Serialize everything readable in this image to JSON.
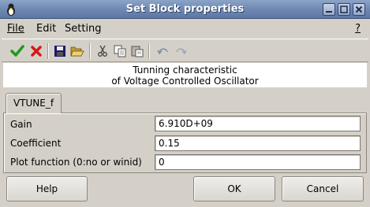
{
  "window": {
    "title": "Set Block properties",
    "controls": [
      "minimize",
      "maximize",
      "close"
    ]
  },
  "menu": {
    "file": "File",
    "edit": "Edit",
    "setting": "Setting",
    "help": "?"
  },
  "toolbar": {
    "icons": [
      "check-icon",
      "cancel-icon",
      "save-icon",
      "open-folder-icon",
      "cut-icon",
      "copy-icon",
      "paste-icon",
      "undo-icon",
      "redo-icon"
    ]
  },
  "description": {
    "line1": "Tunning characteristic",
    "line2": "of Voltage Controlled Oscillator"
  },
  "tab": {
    "label": "VTUNE_f"
  },
  "fields": [
    {
      "label": "Gain",
      "value": "6.910D+09"
    },
    {
      "label": "Coefficient",
      "value": "0.15"
    },
    {
      "label": "Plot function (0:no or winid)",
      "value": "0"
    }
  ],
  "buttons": {
    "help": "Help",
    "ok": "OK",
    "cancel": "Cancel"
  },
  "colors": {
    "titlebar": "#6f89b3",
    "check": "#1f9a1f",
    "cancel": "#d11a1a"
  }
}
